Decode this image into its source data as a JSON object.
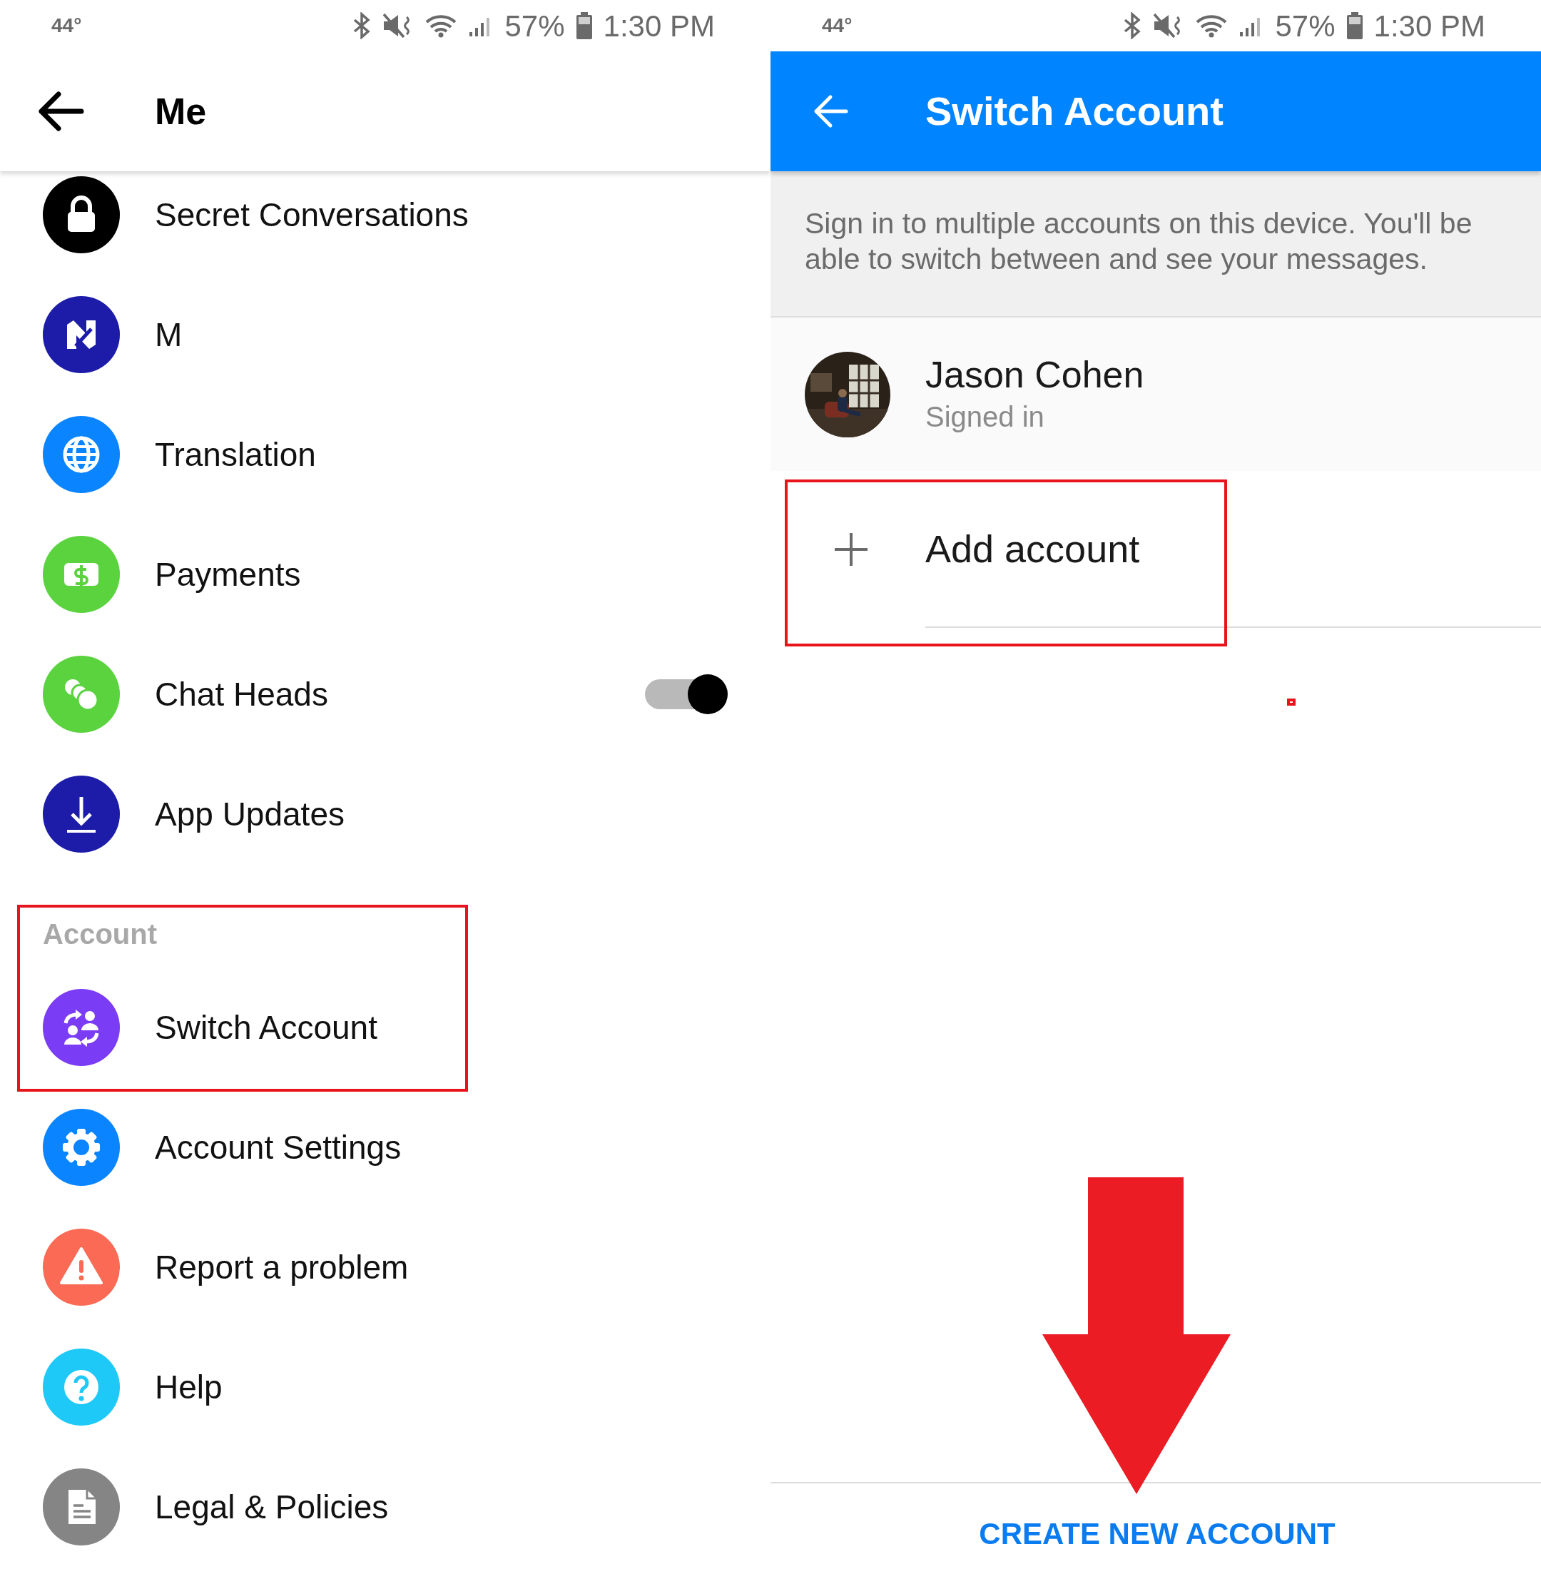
{
  "screens": [
    {
      "kind": "menu",
      "status_bar": {
        "temperature": "44°",
        "battery": "57%",
        "time": "1:30 PM"
      },
      "title": "Me",
      "items": [
        {
          "kind": "item",
          "label": "Secret Conversations",
          "color": "#000000"
        },
        {
          "kind": "item",
          "label": "M",
          "color": "#1c1ca8"
        },
        {
          "kind": "item",
          "label": "Translation",
          "color": "#0a84ff"
        },
        {
          "kind": "item",
          "label": "Payments",
          "color": "#5ad33f"
        },
        {
          "kind": "toggle",
          "label": "Chat Heads",
          "color": "#5ad33f",
          "on": true
        },
        {
          "kind": "item",
          "label": "App Updates",
          "color": "#1c1ca8"
        },
        {
          "kind": "section",
          "label": "Account"
        },
        {
          "kind": "item",
          "label": "Switch Account",
          "color": "#7b3cf5"
        },
        {
          "kind": "item",
          "label": "Account Settings",
          "color": "#0a84ff"
        },
        {
          "kind": "item",
          "label": "Report a problem",
          "color": "#fa6a55"
        },
        {
          "kind": "item",
          "label": "Help",
          "color": "#1ec8f7"
        },
        {
          "kind": "item",
          "label": "Legal & Policies",
          "color": "#858585"
        }
      ]
    },
    {
      "kind": "switch_account",
      "status_bar": {
        "temperature": "44°",
        "battery": "57%",
        "time": "1:30 PM"
      },
      "title": "Switch Account",
      "description": "Sign in to multiple accounts on this device. You'll be able to switch between and see your messages.",
      "accounts": [
        {
          "name": "Jason Cohen",
          "status": "Signed in"
        }
      ],
      "add_label": "Add account",
      "footer_button": "CREATE NEW ACCOUNT"
    }
  ]
}
